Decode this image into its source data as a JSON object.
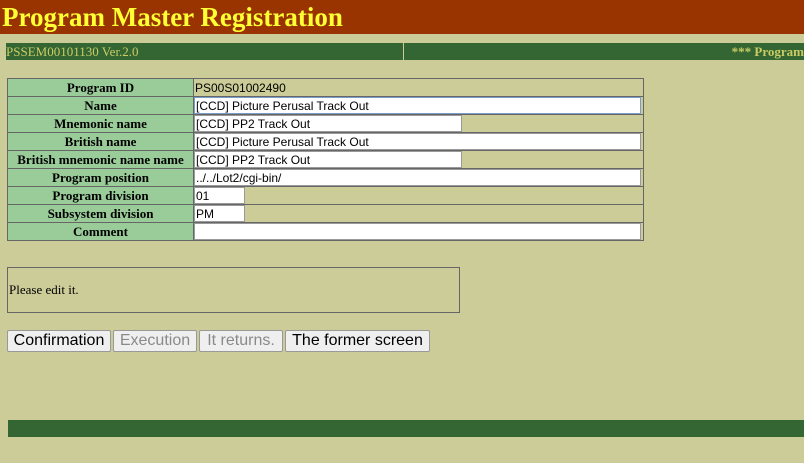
{
  "header": {
    "title": "Program Master Registration"
  },
  "infobar": {
    "version": "PSSEM00101130 Ver.2.0",
    "marquee": "*** Program"
  },
  "form": {
    "program_id": {
      "label": "Program ID",
      "value": "PS00S01002490"
    },
    "name": {
      "label": "Name",
      "value": "[CCD] Picture Perusal Track Out"
    },
    "mnemonic": {
      "label": "Mnemonic name",
      "value": "[CCD] PP2 Track Out"
    },
    "british_name": {
      "label": "British name",
      "value": "[CCD] Picture Perusal Track Out"
    },
    "british_mnemonic": {
      "label": "British mnemonic name name",
      "value": "[CCD] PP2 Track Out"
    },
    "position": {
      "label": "Program position",
      "value": "../../Lot2/cgi-bin/"
    },
    "division": {
      "label": "Program division",
      "value": "01"
    },
    "subsystem": {
      "label": "Subsystem division",
      "value": "PM"
    },
    "comment": {
      "label": "Comment",
      "value": ""
    }
  },
  "message": "Please edit it.",
  "buttons": {
    "confirmation": "Confirmation",
    "execution": "Execution",
    "returns": "It returns.",
    "former": "The former screen"
  }
}
